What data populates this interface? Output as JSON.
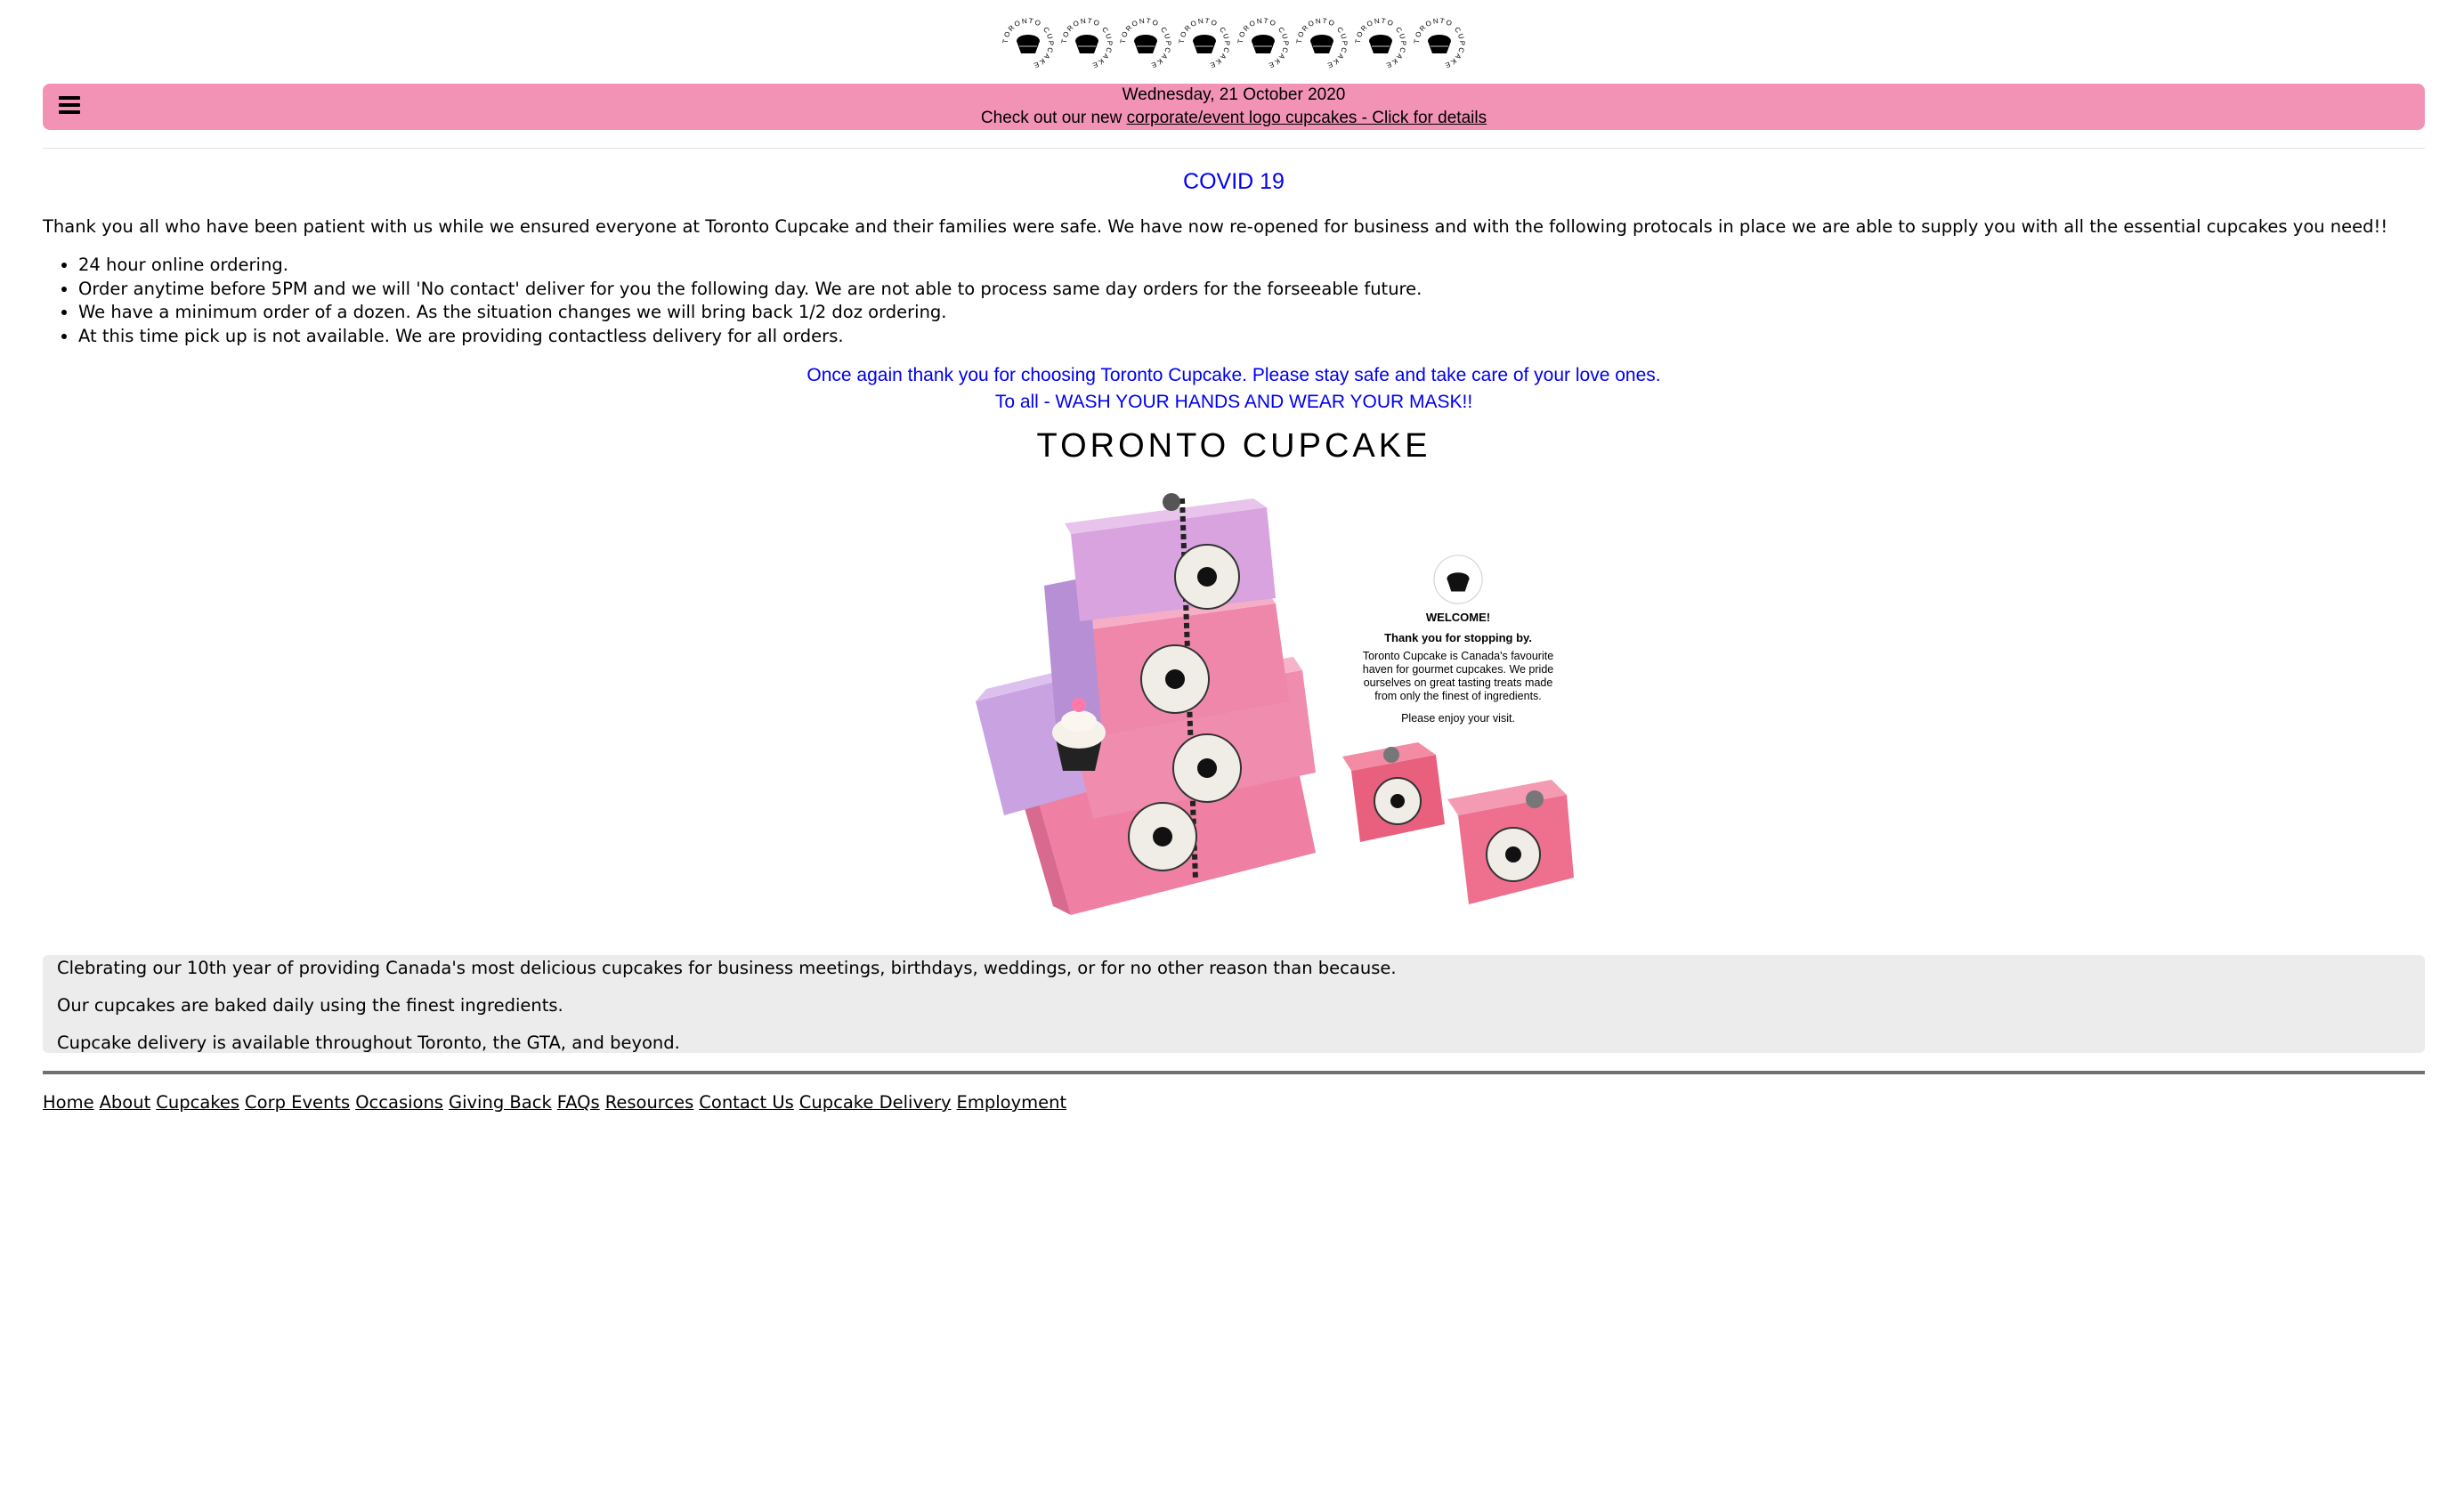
{
  "header": {
    "logo_text": "TORONTO CUPCAKE",
    "logo_count": 8
  },
  "topbar": {
    "date": "Wednesday, 21 October 2020",
    "promo_prefix": "Check out our new",
    "promo_link": "corporate/event logo cupcakes - Click for details",
    "bg_color": "#f293b6"
  },
  "covid": {
    "title": "COVID 19",
    "intro": "Thank you all who have been patient with us while we ensured everyone at Toronto Cupcake and their families were safe. We have now re-opened for business and with the following protocals in place we are able to supply you with all the essential cupcakes you need!!",
    "bullets": [
      "24 hour online ordering.",
      "Order anytime before 5PM and we will 'No contact' deliver for you the following day. We are not able to process same day orders for the forseeable future.",
      "We have a minimum order of a dozen. As the situation changes we will bring back 1/2 doz ordering.",
      "At this time pick up is not available. We are providing contactless delivery for all orders."
    ],
    "note1": "Once again thank you for choosing Toronto Cupcake. Please stay safe and take care of your love ones.",
    "note2": "To all - WASH YOUR HANDS AND WEAR YOUR MASK!!"
  },
  "brand": {
    "title": "TORONTO CUPCAKE"
  },
  "welcome": {
    "title": "WELCOME!",
    "thanks": "Thank you for stopping by.",
    "body": "Toronto Cupcake is Canada's favourite haven for gourmet cupcakes.  We pride ourselves on great tasting treats made from only the finest of ingredients.",
    "enjoy": "Please enjoy your visit."
  },
  "about_panel": {
    "line1": "Clebrating our 10th year of providing Canada's most delicious cupcakes for business meetings, birthdays, weddings, or for no other reason than because.",
    "line2": "Our cupcakes are baked daily using the finest ingredients.",
    "line3": "Cupcake delivery is available throughout Toronto, the GTA, and beyond."
  },
  "footer": {
    "links": [
      "Home",
      "About",
      "Cupcakes",
      "Corp Events",
      "Occasions",
      "Giving Back",
      "FAQs",
      "Resources",
      "Contact Us",
      "Cupcake Delivery",
      "Employment"
    ]
  },
  "colors": {
    "link_blue": "#0000ee",
    "pink": "#f293b6",
    "panel_grey": "#ececec",
    "box_pink": "#f07ca0",
    "box_lavender": "#c8a4e0"
  }
}
